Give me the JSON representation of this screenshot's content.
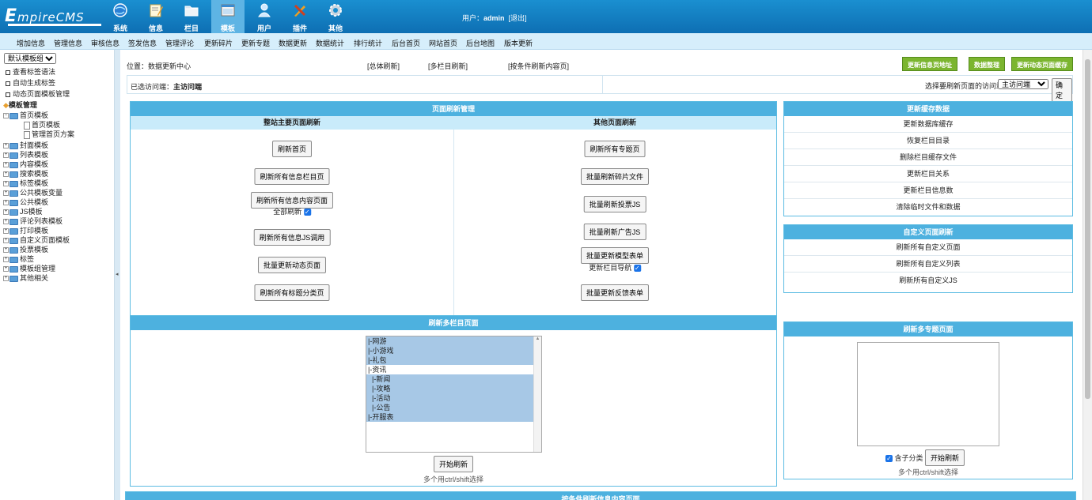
{
  "header": {
    "logo": "EmpireCMS",
    "logo_first": "E",
    "logo_rest": "mpireCMS",
    "nav": [
      {
        "label": "系统",
        "icon": "globe-icon"
      },
      {
        "label": "信息",
        "icon": "pencil-note-icon"
      },
      {
        "label": "栏目",
        "icon": "folder-icon"
      },
      {
        "label": "模板",
        "icon": "window-icon"
      },
      {
        "label": "用户",
        "icon": "user-icon"
      },
      {
        "label": "插件",
        "icon": "tools-icon"
      },
      {
        "label": "其他",
        "icon": "gear-icon"
      }
    ],
    "user_prefix": "用户：",
    "user": "admin",
    "logout": "[退出]"
  },
  "menu": [
    "增加信息",
    "管理信息",
    "审核信息",
    "签发信息",
    "管理评论",
    "更新碎片",
    "更新专题",
    "数据更新",
    "数据统计",
    "排行统计",
    "后台首页",
    "网站首页",
    "后台地图",
    "版本更新"
  ],
  "sidebar": {
    "select": "默认模板组",
    "links": [
      "查看标签语法",
      "自动生成标签",
      "动态页面模板管理"
    ],
    "tree_title": "模板管理",
    "home": "首页模板",
    "home_children": [
      "首页模板",
      "管理首页方案"
    ],
    "folders": [
      "封面模板",
      "列表模板",
      "内容模板",
      "搜索模板",
      "标签模板",
      "公共模板变量",
      "公共模板",
      "JS模板",
      "评论列表模板",
      "打印模板",
      "自定义页面模板",
      "投票模板",
      "标签",
      "模板组管理",
      "其他相关"
    ]
  },
  "toolbar": {
    "location_label": "位置：",
    "location": "数据更新中心",
    "links": [
      "[总体刷新]",
      "[多栏目刷新]",
      "[按条件刷新内容页]"
    ],
    "buttons": [
      "更新信息页地址",
      "数据整理",
      "更新动态页面缓存"
    ],
    "selected_label": "已选访问端：",
    "selected_value": "主访问端",
    "choose_label": "选择要刷新页面的访问端:",
    "choose_value": "主访问端",
    "confirm": "确定"
  },
  "refresh_panel": {
    "title": "页面刷新管理",
    "left_head": "整站主要页面刷新",
    "right_head": "其他页面刷新",
    "left_buttons": [
      "刷新首页",
      "刷新所有信息栏目页",
      "刷新所有信息内容页面",
      "刷新所有信息JS调用",
      "批量更新动态页面",
      "刷新所有标题分类页"
    ],
    "left_check": "全部刷新",
    "right_buttons": [
      "刷新所有专题页",
      "批量刷新碎片文件",
      "批量刷新投票JS",
      "批量刷新广告JS",
      "批量更新模型表单",
      "批量更新反馈表单"
    ],
    "right_check": "更新栏目导航"
  },
  "cache_panel": {
    "title": "更新缓存数据",
    "items": [
      "更新数据库缓存",
      "恢复栏目目录",
      "删除栏目缓存文件",
      "更新栏目关系",
      "更新栏目信息数",
      "清除临时文件和数据"
    ]
  },
  "custom_panel": {
    "title": "自定义页面刷新",
    "items": [
      "刷新所有自定义页面",
      "刷新所有自定义列表",
      "刷新所有自定义JS"
    ]
  },
  "multi_column": {
    "title": "刷新多栏目页面",
    "options": [
      "|-网游",
      "|-小游戏",
      "|-礼包",
      "|-资讯",
      "  |-新闻",
      "  |-攻略",
      "  |-活动",
      "  |-公告",
      "|-开服表"
    ],
    "selected": [
      true,
      true,
      true,
      false,
      true,
      true,
      true,
      true,
      true
    ],
    "button": "开始刷新",
    "hint": "多个用ctrl/shift选择"
  },
  "multi_special": {
    "title": "刷新多专题页面",
    "check": "含子分类",
    "button": "开始刷新",
    "hint": "多个用ctrl/shift选择"
  },
  "bottom_panel": {
    "title": "按条件刷新信息内容页面"
  },
  "colors": {
    "header": "#1a8fd0",
    "panel_head": "#4db1df",
    "green_button": "#7bb52f"
  }
}
